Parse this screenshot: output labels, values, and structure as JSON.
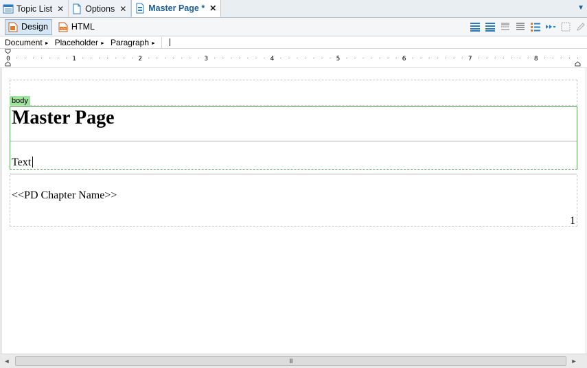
{
  "tabs": [
    {
      "label": "Topic List",
      "icon": "topic-list-icon",
      "active": false
    },
    {
      "label": "Options",
      "icon": "document-icon",
      "active": false
    },
    {
      "label": "Master Page *",
      "icon": "master-page-icon",
      "active": true
    }
  ],
  "tabbar": {
    "overflow_icon": "overflow-chevrons-icon"
  },
  "modes": {
    "design_label": "Design",
    "html_label": "HTML"
  },
  "breadcrumb": {
    "document": "Document",
    "placeholder": "Placeholder",
    "paragraph": "Paragraph"
  },
  "ruler": {
    "numbers": [
      "0",
      "1",
      "2",
      "3",
      "4",
      "5",
      "6",
      "7",
      "8"
    ]
  },
  "page": {
    "body_tag": "body",
    "heading": "Master Page",
    "text": "Text",
    "chapter_name": "<<PD Chapter Name>>",
    "page_number": "1"
  },
  "scrollbar": {
    "grip": "III"
  },
  "colors": {
    "active_tab_text": "#1a5f98",
    "body_tag_bg": "#9de29d",
    "body_border": "#5aa05a"
  }
}
